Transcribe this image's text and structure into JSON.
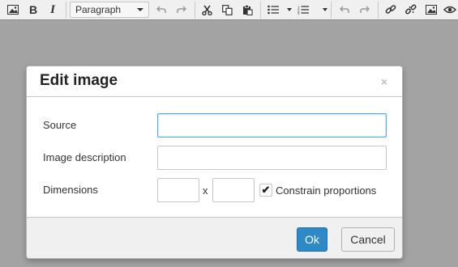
{
  "toolbar": {
    "format_select": "Paragraph",
    "icons": [
      "image-icon",
      "bold-icon",
      "italic-icon",
      "undo-icon",
      "redo-icon",
      "cut-icon",
      "copy-icon",
      "paste-icon",
      "bullet-list-icon",
      "numbered-list-icon",
      "undo-icon",
      "redo-icon",
      "link-icon",
      "unlink-icon",
      "image-icon",
      "preview-icon"
    ]
  },
  "dialog": {
    "title": "Edit image",
    "close": "×",
    "source_label": "Source",
    "source_value": "",
    "description_label": "Image description",
    "description_value": "",
    "dimensions_label": "Dimensions",
    "width_value": "",
    "height_value": "",
    "dimension_separator": "x",
    "constrain_label": "Constrain proportions",
    "constrain_checked": true,
    "checkmark": "✔",
    "ok_label": "Ok",
    "cancel_label": "Cancel"
  },
  "colors": {
    "background": "#a3a3a3",
    "primary_button": "#2d8ac7",
    "focus_border": "#59a5e5"
  }
}
